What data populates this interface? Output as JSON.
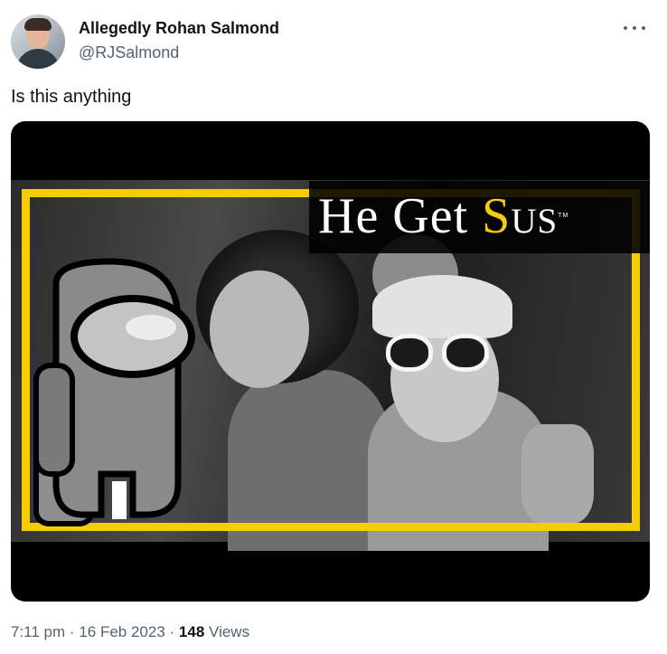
{
  "author": {
    "display_name": "Allegedly Rohan Salmond",
    "handle": "@RJSalmond",
    "avatar_icon": "profile-avatar"
  },
  "tweet": {
    "text": "Is this anything"
  },
  "media": {
    "title_prefix": "He Get ",
    "title_s": "S",
    "title_rest": "us",
    "trademark": "TM",
    "frame_color": "#f6cd00"
  },
  "meta": {
    "time": "7:11 pm",
    "date": "16 Feb 2023",
    "separator": "·",
    "views_count": "148",
    "views_label": "Views"
  },
  "icons": {
    "more": "more-options-icon"
  },
  "colors": {
    "text_primary": "#0f1419",
    "text_secondary": "#536471",
    "accent_yellow": "#f6cd00"
  }
}
